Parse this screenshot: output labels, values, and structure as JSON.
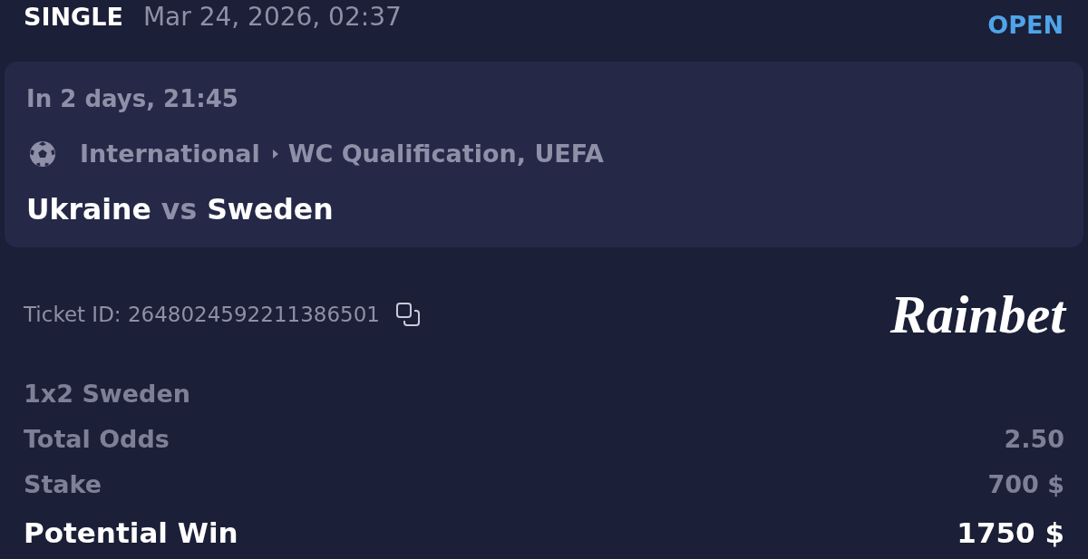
{
  "bet": {
    "type": "SINGLE",
    "placed_at": "Mar 24, 2026, 02:37",
    "status": "OPEN"
  },
  "event": {
    "starts": "In 2 days, 21:45",
    "path": [
      "International",
      "WC Qualification, UEFA"
    ],
    "match": "**Ukraine** vs **Sweden**"
  },
  "ticket": {
    "id": "Ticket ID: 2648024592211386501",
    "logo": "Rainbet"
  },
  "selection": "1x2 Sweden",
  "summary": [
    {
      "kind": "line",
      "label": "Total Odds",
      "value": "2.50"
    },
    {
      "kind": "line",
      "label": "Stake",
      "value": "700 $"
    },
    {
      "kind": "total",
      "label": "Potential Win",
      "value": "1750 $"
    }
  ]
}
